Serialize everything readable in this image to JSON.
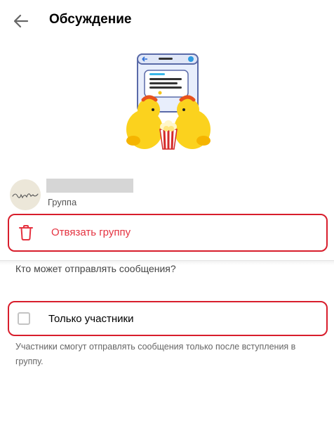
{
  "header": {
    "title": "Обсуждение",
    "back_icon": "arrow-left-icon"
  },
  "group": {
    "type_label": "Группа",
    "avatar_icon": "handwritten-logo"
  },
  "actions": {
    "unlink_label": "Отвязать группу",
    "unlink_icon": "trash-icon",
    "accent_color": "#e53240"
  },
  "permissions": {
    "section_title": "Кто может отправлять сообщения?",
    "members_only_label": "Только участники",
    "members_only_checked": false,
    "hint": "Участники смогут отправлять сообщения только после вступления в группу."
  },
  "highlight_color": "#d81e2c"
}
